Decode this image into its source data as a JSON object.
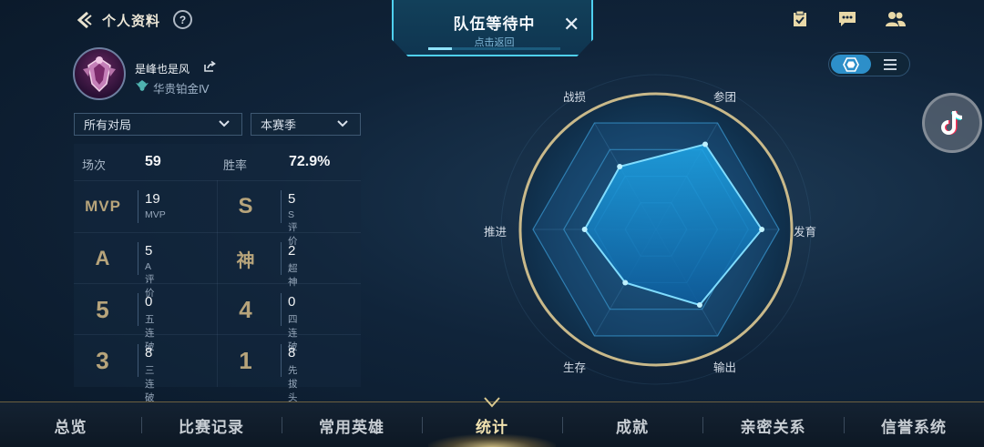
{
  "header": {
    "title": "个人资料",
    "help_label": "?",
    "icons": [
      "back-arrow-icon",
      "help-icon",
      "task-clipboard-icon",
      "chat-icon",
      "friends-icon"
    ]
  },
  "queue": {
    "title": "队伍等待中",
    "subtitle": "点击返回",
    "close_label": "✕",
    "progress": 0.18
  },
  "view_toggle": {
    "options": [
      "radar-view-icon",
      "list-view-icon"
    ],
    "selected": "radar-view-icon"
  },
  "profile": {
    "username": "是峰也是风",
    "rank": "华贵铂金Ⅳ"
  },
  "filters": {
    "mode": "所有对局",
    "season": "本赛季"
  },
  "summary": {
    "matches_label": "场次",
    "matches_value": "59",
    "winrate_label": "胜率",
    "winrate_value": "72.9%"
  },
  "stats": [
    {
      "icon_text": "MVP",
      "value": "19",
      "caption": "MVP"
    },
    {
      "icon_text": "S",
      "value": "5",
      "caption": "S评价"
    },
    {
      "icon_text": "A",
      "value": "5",
      "caption": "A评价"
    },
    {
      "icon_text": "神",
      "value": "2",
      "caption": "超神"
    },
    {
      "icon_text": "5",
      "value": "0",
      "caption": "五连破"
    },
    {
      "icon_text": "4",
      "value": "0",
      "caption": "四连破"
    },
    {
      "icon_text": "3",
      "value": "8",
      "caption": "三连破"
    },
    {
      "icon_text": "1",
      "value": "8",
      "caption": "先拔头筹"
    }
  ],
  "radar": {
    "axes": [
      "战损",
      "参团",
      "发育",
      "输出",
      "生存",
      "推进"
    ],
    "values": [
      0.59,
      0.8,
      0.86,
      0.71,
      0.5,
      0.58
    ],
    "colors": {
      "fill": "#1a86c9",
      "stroke": "#7fdcff",
      "ring": "#c9b98a"
    }
  },
  "nav": {
    "items": [
      "总览",
      "比赛记录",
      "常用英雄",
      "统计",
      "成就",
      "亲密关系",
      "信誉系统"
    ],
    "active": "统计"
  },
  "colors": {
    "accent_gold": "#e9d9a8",
    "accent_cyan": "#4fd0f0",
    "background": "#10243a"
  }
}
